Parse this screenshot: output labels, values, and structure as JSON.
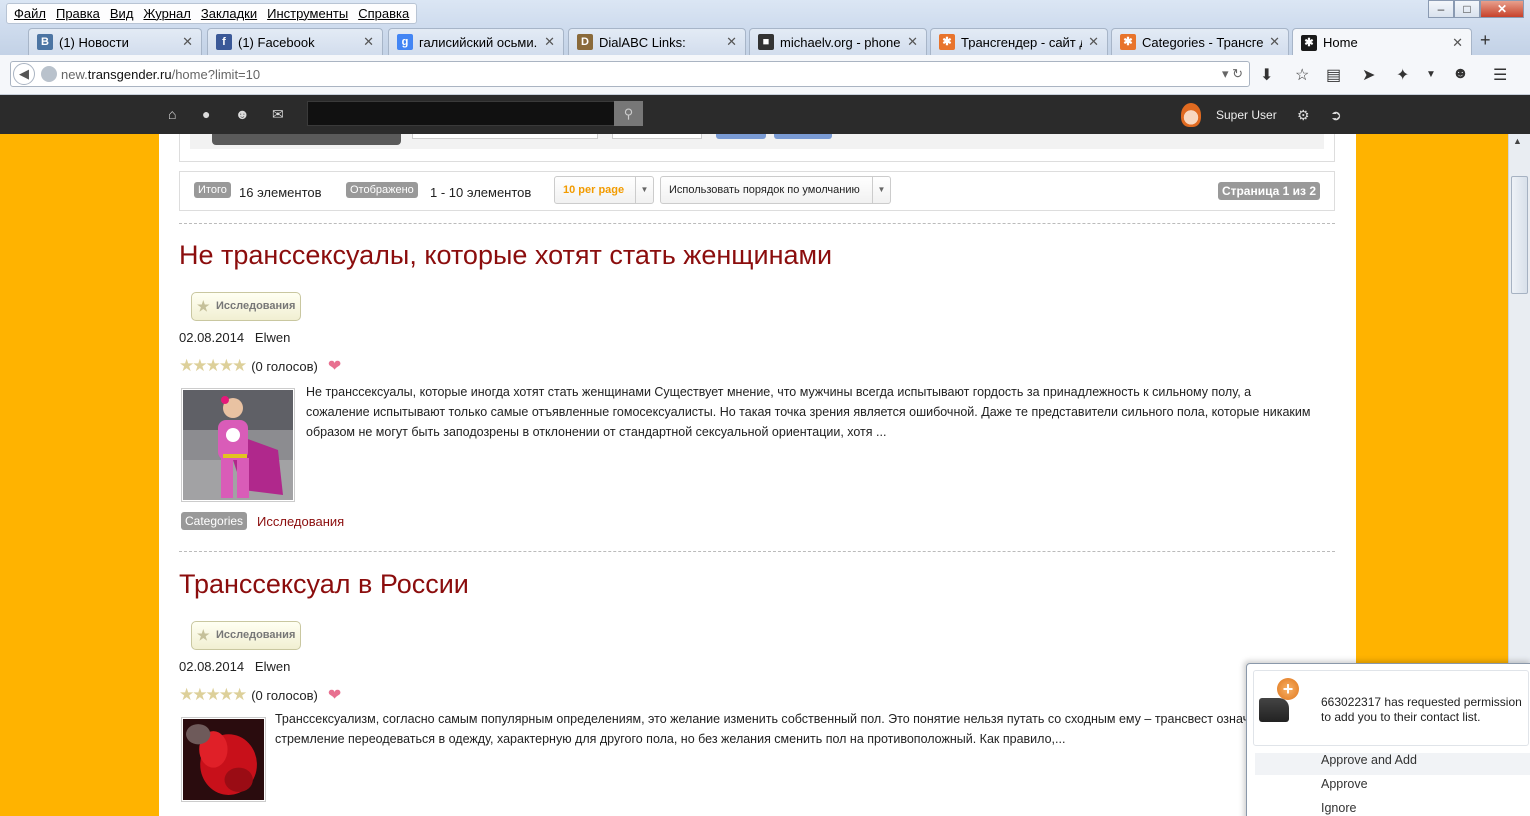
{
  "browser": {
    "menu": [
      "Файл",
      "Правка",
      "Вид",
      "Журнал",
      "Закладки",
      "Инструменты",
      "Справка"
    ],
    "tabs": [
      {
        "label": "(1) Новости",
        "icon": "vk-icon",
        "color": "#4c75a3",
        "glyph": "B"
      },
      {
        "label": "(1) Facebook",
        "icon": "facebook-icon",
        "color": "#3b5998",
        "glyph": "f"
      },
      {
        "label": "галисийский осьми...",
        "icon": "google-icon",
        "color": "#4285f4",
        "glyph": "g"
      },
      {
        "label": "DialABC Links:",
        "icon": "dialabc-icon",
        "color": "#8a6a3a",
        "glyph": "D"
      },
      {
        "label": "michaelv.org - phone...",
        "icon": "michaelv-icon",
        "color": "#333333",
        "glyph": "■"
      },
      {
        "label": "Трансгендер - сайт д...",
        "icon": "joomla-icon",
        "color": "#e8742c",
        "glyph": "✱"
      },
      {
        "label": "Categories - Трансге...",
        "icon": "joomla-icon",
        "color": "#e8742c",
        "glyph": "✱"
      },
      {
        "label": "Home",
        "icon": "joomla-icon",
        "color": "#1a1a1a",
        "glyph": "✱",
        "active": true
      }
    ],
    "url_prefix": "new.",
    "url_domain": "transgender.ru",
    "url_path": "/home?limit=10"
  },
  "sitenav": {
    "user": "Super User"
  },
  "list": {
    "total_label": "Итого",
    "total_value": "16 элементов",
    "shown_label": "Отображено",
    "shown_value": "1 - 10 элементов",
    "per_page": "10 per page",
    "order": "Использовать порядок по умолчанию",
    "page_info": "Страница 1 из 2"
  },
  "articles": [
    {
      "title": "Не транссексуалы, которые хотят стать женщинами",
      "category": "Исследования",
      "date": "02.08.2014",
      "author": "Elwen",
      "votes": "(0 голосов)",
      "intro": "Не транссексуалы, которые иногда хотят стать женщинами Существует мнение, что мужчины всегда испытывают гордость за принадлежность к сильному полу, а сожаление испытывают только самые отъявленные гомосексуалисты. Но такая точка зрения является ошибочной. Даже те представители сильного пола, которые никаким образом не могут быть заподозрены в отклонении от стандартной сексуальной ориентации, хотя ...",
      "categories_label": "Categories",
      "categories_link": "Исследования"
    },
    {
      "title": "Транссексуал в России",
      "category": "Исследования",
      "date": "02.08.2014",
      "author": "Elwen",
      "votes": "(0 голосов)",
      "intro": "Транссексуализм, согласно самым популярным определениям, это желание изменить собственный пол. Это понятие нельзя путать со сходным ему – трансвест означает лишь стремление переодеваться в одежду, характерную для другого пола, но без желания сменить пол на противоположный. Как правило,..."
    }
  ],
  "popup": {
    "message": "663022317 has requested permission to add you to their contact list.",
    "options": [
      "Approve and Add",
      "Approve",
      "Ignore"
    ]
  }
}
